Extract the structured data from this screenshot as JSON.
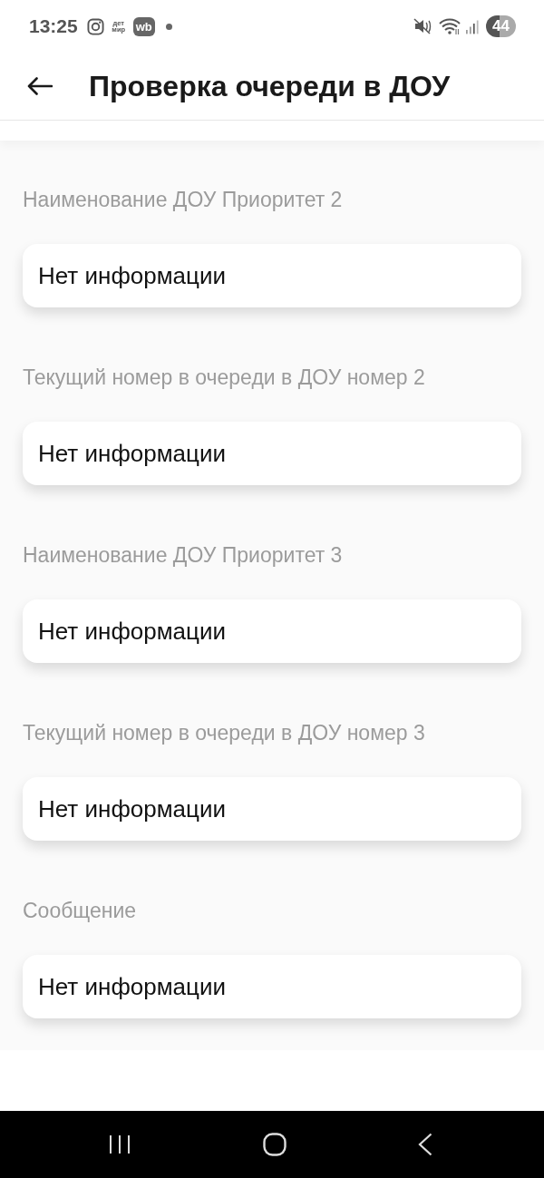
{
  "status_bar": {
    "time": "13:25",
    "notification_icons": [
      {
        "kind": "instagram"
      },
      {
        "kind": "text-logo",
        "label": "дет мир"
      },
      {
        "kind": "badge-logo",
        "label": "wb"
      },
      {
        "kind": "dot"
      }
    ],
    "battery": "44"
  },
  "header": {
    "title": "Проверка очереди в ДОУ"
  },
  "fields": [
    {
      "label": "Наименование ДОУ Приоритет 2",
      "value": "Нет информации"
    },
    {
      "label": "Текущий номер в очереди в ДОУ номер 2",
      "value": "Нет информации"
    },
    {
      "label": "Наименование ДОУ Приоритет 3",
      "value": "Нет информации"
    },
    {
      "label": "Текущий номер в очереди в ДОУ номер 3",
      "value": "Нет информации"
    },
    {
      "label": "Сообщение",
      "value": "Нет информации"
    }
  ],
  "nav_bar": {
    "buttons": [
      {
        "kind": "recent"
      },
      {
        "kind": "home"
      },
      {
        "kind": "back"
      }
    ]
  }
}
